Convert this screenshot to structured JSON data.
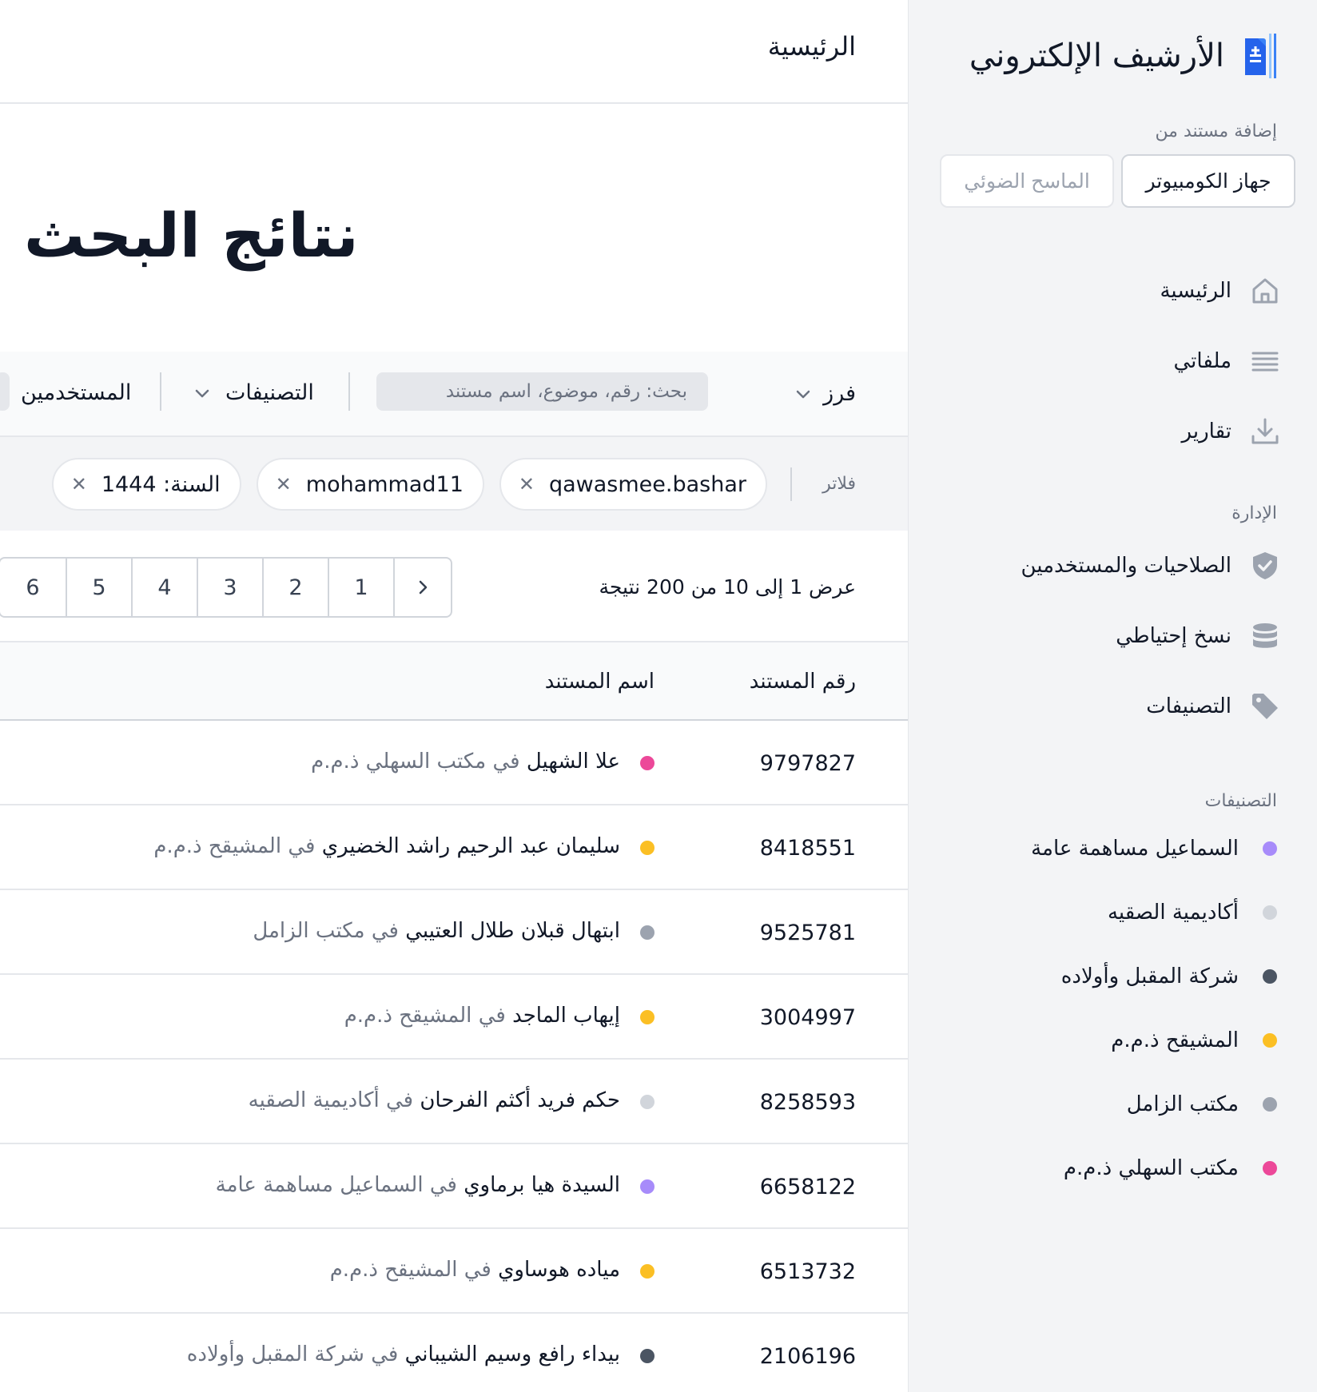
{
  "app": {
    "title": "الأرشيف الإلكتروني",
    "logo_icon": "archive-document-icon"
  },
  "add_document": {
    "label": "إضافة مستند من",
    "computer": "جهاز الكومبيوتر",
    "scanner": "الماسح الضوئي"
  },
  "nav": {
    "items": [
      {
        "label": "الرئيسية",
        "icon": "home-icon"
      },
      {
        "label": "ملفاتي",
        "icon": "list-icon"
      },
      {
        "label": "تقارير",
        "icon": "download-icon"
      }
    ]
  },
  "admin": {
    "title": "الإدارة",
    "items": [
      {
        "label": "الصلاحيات والمستخدمين",
        "icon": "shield-check-icon"
      },
      {
        "label": "نسخ إحتياطي",
        "icon": "database-icon"
      },
      {
        "label": "التصنيفات",
        "icon": "tag-icon"
      }
    ]
  },
  "categories": {
    "title": "التصنيفات",
    "items": [
      {
        "label": "السماعيل مساهمة عامة",
        "color": "#a78bfa"
      },
      {
        "label": "أكاديمية الصقيه",
        "color": "#d1d5db"
      },
      {
        "label": "شركة المقبل وأولاده",
        "color": "#4b5563"
      },
      {
        "label": "المشيقح ذ.م.م",
        "color": "#fbbf24"
      },
      {
        "label": "مكتب الزامل",
        "color": "#9ca3af"
      },
      {
        "label": "مكتب السهلي ذ.م.م",
        "color": "#ec4899"
      }
    ]
  },
  "header": {
    "breadcrumb": "الرئيسية",
    "page_title": "نتائج البحث"
  },
  "toolbar": {
    "sort_label": "فرز",
    "search_placeholder": "بحث: رقم، موضوع، اسم مستند",
    "categories_label": "التصنيفات",
    "users_label": "المستخدمين"
  },
  "filters": {
    "label": "فلاتر",
    "chips": [
      "qawasmee.bashar",
      "mohammad11",
      "السنة: 1444"
    ]
  },
  "results": {
    "info": "عرض 1 إلى 10 من 200 نتيجة",
    "pages": [
      "1",
      "2",
      "3",
      "4",
      "5",
      "6"
    ]
  },
  "table": {
    "col_number": "رقم المستند",
    "col_name": "اسم المستند",
    "in_word": "في",
    "rows": [
      {
        "number": "9797827",
        "person": "علا الشهيل",
        "org": "مكتب السهلي ذ.م.م",
        "color": "#ec4899"
      },
      {
        "number": "8418551",
        "person": "سليمان عبد الرحيم راشد الخضيري",
        "org": "المشيقح ذ.م.م",
        "color": "#fbbf24"
      },
      {
        "number": "9525781",
        "person": "ابتهال قبلان طلال العتيبي",
        "org": "مكتب الزامل",
        "color": "#9ca3af"
      },
      {
        "number": "3004997",
        "person": "إيهاب الماجد",
        "org": "المشيقح ذ.م.م",
        "color": "#fbbf24"
      },
      {
        "number": "8258593",
        "person": "حكم فريد أكثم الفرحان",
        "org": "أكاديمية الصقيه",
        "color": "#d1d5db"
      },
      {
        "number": "6658122",
        "person": "السيدة هيا برماوي",
        "org": "السماعيل مساهمة عامة",
        "color": "#a78bfa"
      },
      {
        "number": "6513732",
        "person": "مياده هوساوي",
        "org": "المشيقح ذ.م.م",
        "color": "#fbbf24"
      },
      {
        "number": "2106196",
        "person": "بيداء رافع وسيم الشيباني",
        "org": "شركة المقبل وأولاده",
        "color": "#4b5563"
      }
    ]
  }
}
